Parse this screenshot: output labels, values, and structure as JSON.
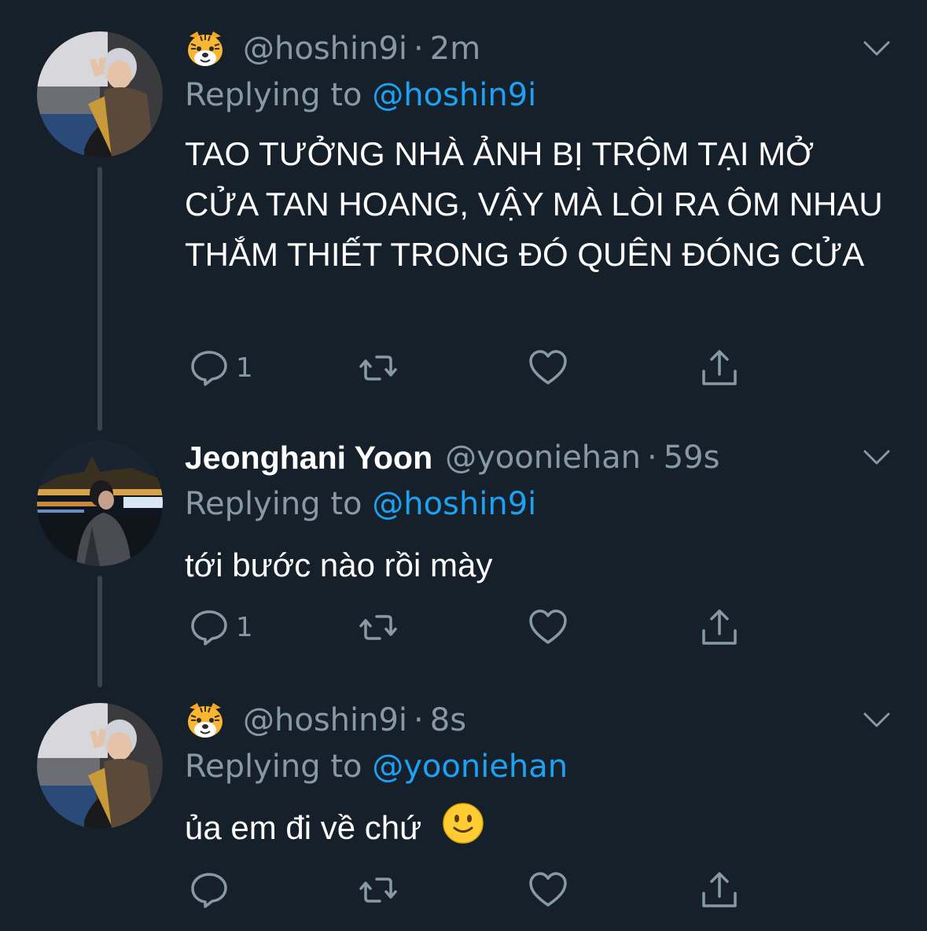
{
  "colors": {
    "background": "#15202b",
    "text_primary": "#ffffff",
    "text_secondary": "#8899a6",
    "link": "#1da1f2",
    "thread_line": "#38444d"
  },
  "tweets": [
    {
      "display_name": "",
      "name_icon": "tiger-face-emoji",
      "handle": "@hoshin9i",
      "separator": "·",
      "time": "2m",
      "replying_prefix": "Replying to",
      "replying_to": "@hoshin9i",
      "body": "TAO TƯỞNG NHÀ ẢNH BỊ TRỘM TẠI MỞ CỬA TAN HOANG, VẬY MÀ LÒI RA ÔM NHAU THẮM THIẾT TRONG ĐÓ QUÊN ĐÓNG CỬA",
      "reply_count": "1",
      "retweet_count": "",
      "like_count": ""
    },
    {
      "display_name": "Jeonghani Yoon",
      "name_icon": "",
      "handle": "@yooniehan",
      "separator": "·",
      "time": "59s",
      "replying_prefix": "Replying to",
      "replying_to": "@hoshin9i",
      "body": "tới bước nào rồi mày",
      "reply_count": "1",
      "retweet_count": "",
      "like_count": ""
    },
    {
      "display_name": "",
      "name_icon": "tiger-face-emoji",
      "handle": "@hoshin9i",
      "separator": "·",
      "time": "8s",
      "replying_prefix": "Replying to",
      "replying_to": "@yooniehan",
      "body": "ủa em đi về chứ",
      "body_emoji": "slightly-smiling-face-emoji",
      "reply_count": "",
      "retweet_count": "",
      "like_count": ""
    }
  ]
}
